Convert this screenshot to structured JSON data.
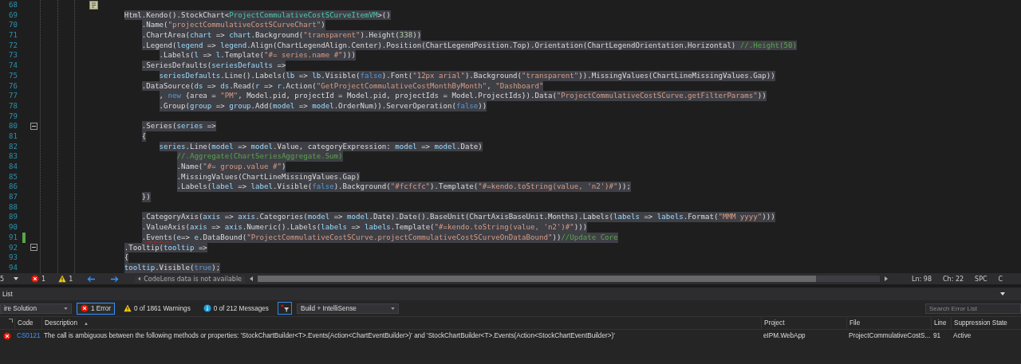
{
  "editor": {
    "lines": [
      {
        "number": "68",
        "kind": "marker",
        "selected": false,
        "changed": false,
        "fold": false
      },
      {
        "number": "69",
        "kind": "code",
        "selected": true,
        "changed": false,
        "fold": false,
        "tokens": [
          {
            "kind": "plain",
            "text": "        Html.Kendo().StockChart<"
          },
          {
            "kind": "type",
            "text": "ProjectCommulativeCostSCurveItemVM"
          },
          {
            "kind": "plain",
            "text": ">()"
          }
        ]
      },
      {
        "number": "70",
        "kind": "code",
        "selected": true,
        "changed": false,
        "fold": false,
        "tokens": [
          {
            "kind": "plain",
            "text": "            .Name("
          },
          {
            "kind": "string",
            "text": "\"projectCommulativeCostSCurveChart\""
          },
          {
            "kind": "plain",
            "text": ")"
          }
        ]
      },
      {
        "number": "71",
        "kind": "code",
        "selected": true,
        "changed": false,
        "fold": false,
        "tokens": [
          {
            "kind": "plain",
            "text": "            .ChartArea("
          },
          {
            "kind": "ident",
            "text": "chart"
          },
          {
            "kind": "plain",
            "text": " => "
          },
          {
            "kind": "ident",
            "text": "chart"
          },
          {
            "kind": "plain",
            "text": ".Background("
          },
          {
            "kind": "string",
            "text": "\"transparent\""
          },
          {
            "kind": "plain",
            "text": ").Height("
          },
          {
            "kind": "number",
            "text": "338"
          },
          {
            "kind": "plain",
            "text": "))"
          }
        ]
      },
      {
        "number": "72",
        "kind": "code",
        "selected": true,
        "changed": false,
        "fold": false,
        "tokens": [
          {
            "kind": "plain",
            "text": "            .Legend("
          },
          {
            "kind": "ident",
            "text": "legend"
          },
          {
            "kind": "plain",
            "text": " => "
          },
          {
            "kind": "ident",
            "text": "legend"
          },
          {
            "kind": "plain",
            "text": ".Align(ChartLegendAlign.Center).Position(ChartLegendPosition.Top).Orientation(ChartLegendOrientation.Horizontal) "
          },
          {
            "kind": "comment",
            "text": "//.Height(50)"
          }
        ]
      },
      {
        "number": "73",
        "kind": "code",
        "selected": true,
        "changed": false,
        "fold": false,
        "tokens": [
          {
            "kind": "plain",
            "text": "                .Labels("
          },
          {
            "kind": "ident",
            "text": "l"
          },
          {
            "kind": "plain",
            "text": " => "
          },
          {
            "kind": "ident",
            "text": "l"
          },
          {
            "kind": "plain",
            "text": ".Template("
          },
          {
            "kind": "string",
            "text": "\"#= series.name #\""
          },
          {
            "kind": "plain",
            "text": ")))"
          }
        ]
      },
      {
        "number": "74",
        "kind": "code",
        "selected": true,
        "changed": false,
        "fold": false,
        "tokens": [
          {
            "kind": "plain",
            "text": "            .SeriesDefaults("
          },
          {
            "kind": "ident",
            "text": "seriesDefaults"
          },
          {
            "kind": "plain",
            "text": " =>"
          }
        ]
      },
      {
        "number": "75",
        "kind": "code",
        "selected": true,
        "changed": false,
        "fold": false,
        "tokens": [
          {
            "kind": "ident",
            "text": "                seriesDefaults"
          },
          {
            "kind": "plain",
            "text": ".Line().Labels("
          },
          {
            "kind": "ident",
            "text": "lb"
          },
          {
            "kind": "plain",
            "text": " => "
          },
          {
            "kind": "ident",
            "text": "lb"
          },
          {
            "kind": "plain",
            "text": ".Visible("
          },
          {
            "kind": "keyword",
            "text": "false"
          },
          {
            "kind": "plain",
            "text": ").Font("
          },
          {
            "kind": "string",
            "text": "\"12px arial\""
          },
          {
            "kind": "plain",
            "text": ").Background("
          },
          {
            "kind": "string",
            "text": "\"transparent\""
          },
          {
            "kind": "plain",
            "text": ")).MissingValues(ChartLineMissingValues.Gap))"
          }
        ]
      },
      {
        "number": "76",
        "kind": "code",
        "selected": true,
        "changed": false,
        "fold": false,
        "tokens": [
          {
            "kind": "plain",
            "text": "            .DataSource("
          },
          {
            "kind": "ident",
            "text": "ds"
          },
          {
            "kind": "plain",
            "text": " => "
          },
          {
            "kind": "ident",
            "text": "ds"
          },
          {
            "kind": "plain",
            "text": ".Read("
          },
          {
            "kind": "ident",
            "text": "r"
          },
          {
            "kind": "plain",
            "text": " => "
          },
          {
            "kind": "ident",
            "text": "r"
          },
          {
            "kind": "plain",
            "text": ".Action("
          },
          {
            "kind": "string",
            "text": "\"GetProjectCommulativeCostMonthByMonth\""
          },
          {
            "kind": "plain",
            "text": ", "
          },
          {
            "kind": "string",
            "text": "\"Dashboard\""
          }
        ]
      },
      {
        "number": "77",
        "kind": "code",
        "selected": true,
        "changed": false,
        "fold": false,
        "tokens": [
          {
            "kind": "plain",
            "text": "                , "
          },
          {
            "kind": "keyword",
            "text": "new"
          },
          {
            "kind": "plain",
            "text": " {area = "
          },
          {
            "kind": "string",
            "text": "\"PM\""
          },
          {
            "kind": "plain",
            "text": ", Model.pid, projectId = Model.pid, projectIds = Model.ProjectIds}).Data("
          },
          {
            "kind": "string",
            "text": "\"ProjectCommulativeCostSCurve.getFilterParams\""
          },
          {
            "kind": "plain",
            "text": "))"
          }
        ]
      },
      {
        "number": "78",
        "kind": "code",
        "selected": true,
        "changed": false,
        "fold": false,
        "tokens": [
          {
            "kind": "plain",
            "text": "                .Group("
          },
          {
            "kind": "ident",
            "text": "group"
          },
          {
            "kind": "plain",
            "text": " => "
          },
          {
            "kind": "ident",
            "text": "group"
          },
          {
            "kind": "plain",
            "text": ".Add("
          },
          {
            "kind": "ident",
            "text": "model"
          },
          {
            "kind": "plain",
            "text": " => "
          },
          {
            "kind": "ident",
            "text": "model"
          },
          {
            "kind": "plain",
            "text": ".OrderNum)).ServerOperation("
          },
          {
            "kind": "keyword",
            "text": "false"
          },
          {
            "kind": "plain",
            "text": "))"
          }
        ]
      },
      {
        "number": "79",
        "kind": "code",
        "selected": false,
        "changed": false,
        "fold": false
      },
      {
        "number": "80",
        "kind": "code",
        "selected": true,
        "changed": false,
        "fold": true,
        "tokens": [
          {
            "kind": "plain",
            "text": "            .Series("
          },
          {
            "kind": "ident",
            "text": "series"
          },
          {
            "kind": "plain",
            "text": " =>"
          }
        ]
      },
      {
        "number": "81",
        "kind": "code",
        "selected": true,
        "changed": false,
        "fold": false,
        "tokens": [
          {
            "kind": "plain",
            "text": "            {"
          }
        ]
      },
      {
        "number": "82",
        "kind": "code",
        "selected": true,
        "changed": false,
        "fold": false,
        "tokens": [
          {
            "kind": "ident",
            "text": "                series"
          },
          {
            "kind": "plain",
            "text": ".Line("
          },
          {
            "kind": "ident",
            "text": "model"
          },
          {
            "kind": "plain",
            "text": " => "
          },
          {
            "kind": "ident",
            "text": "model"
          },
          {
            "kind": "plain",
            "text": ".Value, categoryExpression: "
          },
          {
            "kind": "ident",
            "text": "model"
          },
          {
            "kind": "plain",
            "text": " => "
          },
          {
            "kind": "ident",
            "text": "model"
          },
          {
            "kind": "plain",
            "text": ".Date)"
          }
        ]
      },
      {
        "number": "83",
        "kind": "code",
        "selected": true,
        "changed": false,
        "fold": false,
        "tokens": [
          {
            "kind": "comment",
            "text": "                    //.Aggregate(ChartSeriesAggregate.Sum)"
          }
        ]
      },
      {
        "number": "84",
        "kind": "code",
        "selected": true,
        "changed": false,
        "fold": false,
        "tokens": [
          {
            "kind": "plain",
            "text": "                    .Name("
          },
          {
            "kind": "string",
            "text": "\"#= group.value #\""
          },
          {
            "kind": "plain",
            "text": ")"
          }
        ]
      },
      {
        "number": "85",
        "kind": "code",
        "selected": true,
        "changed": false,
        "fold": false,
        "tokens": [
          {
            "kind": "plain",
            "text": "                    .MissingValues(ChartLineMissingValues.Gap)"
          }
        ]
      },
      {
        "number": "86",
        "kind": "code",
        "selected": true,
        "changed": false,
        "fold": false,
        "tokens": [
          {
            "kind": "plain",
            "text": "                    .Labels("
          },
          {
            "kind": "ident",
            "text": "label"
          },
          {
            "kind": "plain",
            "text": " => "
          },
          {
            "kind": "ident",
            "text": "label"
          },
          {
            "kind": "plain",
            "text": ".Visible("
          },
          {
            "kind": "keyword",
            "text": "false"
          },
          {
            "kind": "plain",
            "text": ").Background("
          },
          {
            "kind": "string",
            "text": "\"#fcfcfc\""
          },
          {
            "kind": "plain",
            "text": ").Template("
          },
          {
            "kind": "string",
            "text": "\"#=kendo.toString(value, 'n2')#\""
          },
          {
            "kind": "plain",
            "text": "));"
          }
        ]
      },
      {
        "number": "87",
        "kind": "code",
        "selected": true,
        "changed": false,
        "fold": false,
        "tokens": [
          {
            "kind": "plain",
            "text": "            })"
          }
        ]
      },
      {
        "number": "88",
        "kind": "code",
        "selected": false,
        "changed": false,
        "fold": false
      },
      {
        "number": "89",
        "kind": "code",
        "selected": true,
        "changed": false,
        "fold": false,
        "tokens": [
          {
            "kind": "plain",
            "text": "            .CategoryAxis("
          },
          {
            "kind": "ident",
            "text": "axis"
          },
          {
            "kind": "plain",
            "text": " => "
          },
          {
            "kind": "ident",
            "text": "axis"
          },
          {
            "kind": "plain",
            "text": ".Categories("
          },
          {
            "kind": "ident",
            "text": "model"
          },
          {
            "kind": "plain",
            "text": " => "
          },
          {
            "kind": "ident",
            "text": "model"
          },
          {
            "kind": "plain",
            "text": ".Date).Date().BaseUnit(ChartAxisBaseUnit.Months).Labels("
          },
          {
            "kind": "ident",
            "text": "labels"
          },
          {
            "kind": "plain",
            "text": " => "
          },
          {
            "kind": "ident",
            "text": "labels"
          },
          {
            "kind": "plain",
            "text": ".Format("
          },
          {
            "kind": "string",
            "text": "\"MMM yyyy\""
          },
          {
            "kind": "plain",
            "text": ")))"
          }
        ]
      },
      {
        "number": "90",
        "kind": "code",
        "selected": true,
        "changed": false,
        "fold": false,
        "tokens": [
          {
            "kind": "plain",
            "text": "            .ValueAxis("
          },
          {
            "kind": "ident",
            "text": "axis"
          },
          {
            "kind": "plain",
            "text": " => "
          },
          {
            "kind": "ident",
            "text": "axis"
          },
          {
            "kind": "plain",
            "text": ".Numeric().Labels("
          },
          {
            "kind": "ident",
            "text": "labels"
          },
          {
            "kind": "plain",
            "text": " => "
          },
          {
            "kind": "ident",
            "text": "labels"
          },
          {
            "kind": "plain",
            "text": ".Template("
          },
          {
            "kind": "string",
            "text": "\"#=kendo.toString(value, 'n2')#\""
          },
          {
            "kind": "plain",
            "text": ")))"
          }
        ]
      },
      {
        "number": "91",
        "kind": "code",
        "selected": true,
        "changed": true,
        "fold": false,
        "tokens": [
          {
            "kind": "plain",
            "text": "            ."
          },
          {
            "kind": "error",
            "text": "Events"
          },
          {
            "kind": "plain",
            "text": "("
          },
          {
            "kind": "ident",
            "text": "e"
          },
          {
            "kind": "plain",
            "text": "=> "
          },
          {
            "kind": "ident",
            "text": "e"
          },
          {
            "kind": "plain",
            "text": ".DataBound("
          },
          {
            "kind": "string",
            "text": "\"ProjectCommulativeCostSCurve.projectCommulativeCostSCurveOnDataBound\""
          },
          {
            "kind": "plain",
            "text": "))"
          },
          {
            "kind": "comment",
            "text": "//Update Core"
          }
        ]
      },
      {
        "number": "92",
        "kind": "code",
        "selected": true,
        "changed": false,
        "fold": true,
        "tokens": [
          {
            "kind": "plain",
            "text": "        .Tooltip("
          },
          {
            "kind": "ident",
            "text": "tooltip"
          },
          {
            "kind": "plain",
            "text": " =>"
          }
        ]
      },
      {
        "number": "93",
        "kind": "code",
        "selected": true,
        "changed": false,
        "fold": false,
        "tokens": [
          {
            "kind": "plain",
            "text": "        {"
          }
        ]
      },
      {
        "number": "94",
        "kind": "code",
        "selected": true,
        "changed": false,
        "fold": false,
        "tokens": [
          {
            "kind": "ident",
            "text": "        tooltip"
          },
          {
            "kind": "plain",
            "text": ".Visible("
          },
          {
            "kind": "keyword",
            "text": "true"
          },
          {
            "kind": "plain",
            "text": ");"
          }
        ]
      }
    ]
  },
  "status_bar": {
    "zoom": "5",
    "errors": "1",
    "warnings": "1",
    "codelens": "CodeLens data is not available",
    "line": "Ln: 98",
    "column": "Ch: 22",
    "indent_mode": "SPC",
    "encoding": "C"
  },
  "error_list": {
    "title": "List",
    "scope": "ire Solution",
    "filters": [
      {
        "kind": "error",
        "label": "1 Error",
        "selected": true
      },
      {
        "kind": "warning",
        "label": "0 of 1861 Warnings",
        "selected": false
      },
      {
        "kind": "message",
        "label": "0 of 212 Messages",
        "selected": false
      }
    ],
    "build_filter": "Build + IntelliSense",
    "search": {
      "placeholder": "Search Error List"
    },
    "columns": [
      {
        "label": "Code"
      },
      {
        "label": "Description",
        "sort_mark": "▲"
      },
      {
        "label": "Project"
      },
      {
        "label": "File"
      },
      {
        "label": "Line"
      },
      {
        "label": "Suppression State"
      }
    ],
    "rows": [
      {
        "kind": "error",
        "code": "CS0121",
        "description": "The call is ambiguous between the following methods or properties: 'StockChartBuilder<T>.Events(Action<ChartEventBuilder>)' and 'StockChartBuilder<T>.Events(Action<StockChartEventBuilder>)'",
        "project": "eIPM.WebApp",
        "file": "ProjectCommulativeCostS...",
        "line": "91",
        "suppression": "Active"
      }
    ]
  }
}
